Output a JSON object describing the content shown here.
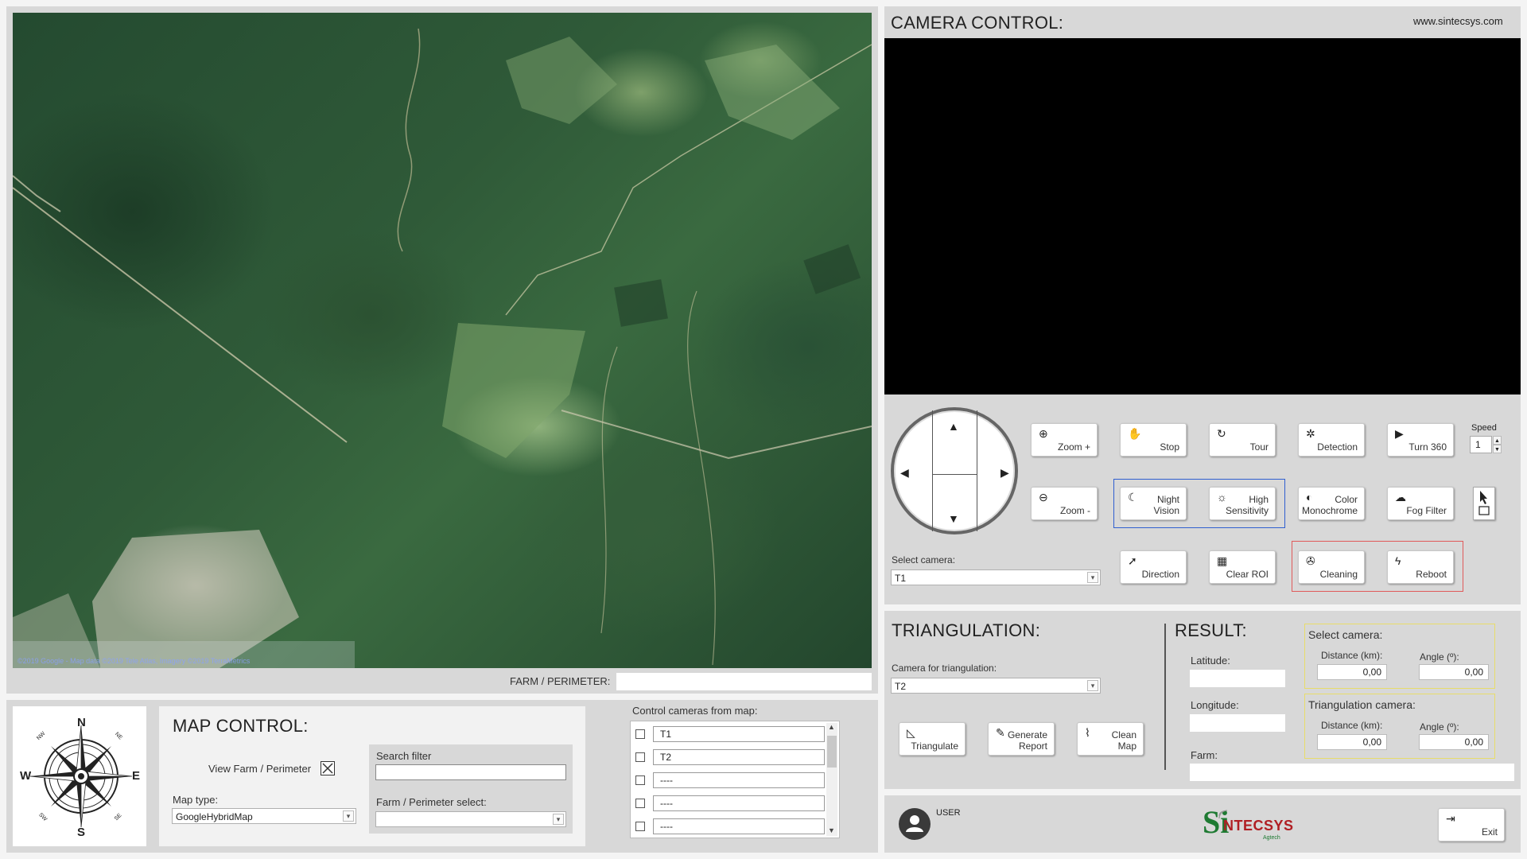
{
  "map": {
    "credit": "©2019 Google - Map data ©2019 Tele Atlas, Imagery ©2019 TerraMetrics",
    "farm_label": "FARM / PERIMETER:",
    "farm_value": ""
  },
  "compass": {
    "n": "N",
    "s": "S",
    "e": "E",
    "w": "W",
    "ne": "NE",
    "nw": "NW",
    "se": "SE",
    "sw": "SW"
  },
  "map_control": {
    "title": "MAP CONTROL:",
    "view_farm_label": "View Farm / Perimeter",
    "view_farm_checked": true,
    "map_type_label": "Map type:",
    "map_type_value": "GoogleHybridMap",
    "search_filter_label": "Search filter",
    "search_filter_value": "",
    "farm_select_label": "Farm / Perimeter select:",
    "farm_select_value": ""
  },
  "control_cameras": {
    "label": "Control cameras from map:",
    "items": [
      {
        "label": "T1",
        "checked": false
      },
      {
        "label": "T2",
        "checked": false
      },
      {
        "label": "----",
        "checked": false
      },
      {
        "label": "----",
        "checked": false
      },
      {
        "label": "----",
        "checked": false
      }
    ]
  },
  "camera_control": {
    "title": "CAMERA CONTROL:",
    "website": "www.sintecsys.com",
    "select_camera_label": "Select camera:",
    "select_camera_value": "T1",
    "speed_label": "Speed",
    "speed_value": "1",
    "buttons": {
      "zoom_in": "Zoom +",
      "zoom_out": "Zoom -",
      "stop": "Stop",
      "tour": "Tour",
      "detection": "Detection",
      "turn360": "Turn  360",
      "night_vision_1": "Night",
      "night_vision_2": "Vision",
      "high_sens_1": "High",
      "high_sens_2": "Sensitivity",
      "color_mono_1": "Color",
      "color_mono_2": "Monochrome",
      "fog_filter": "Fog Filter",
      "direction": "Direction",
      "clear_roi": "Clear ROI",
      "cleaning": "Cleaning",
      "reboot": "Reboot"
    }
  },
  "triangulation": {
    "title": "TRIANGULATION:",
    "camera_label": "Camera for triangulation:",
    "camera_value": "T2",
    "triangulate": "Triangulate",
    "generate_report_1": "Generate",
    "generate_report_2": "Report",
    "clean_map_1": "Clean",
    "clean_map_2": "Map"
  },
  "result": {
    "title": "RESULT:",
    "latitude_label": "Latitude:",
    "latitude_value": "",
    "longitude_label": "Longitude:",
    "longitude_value": "",
    "farm_label": "Farm:",
    "farm_value": "",
    "select_camera_title": "Select camera:",
    "triangulation_camera_title": "Triangulation camera:",
    "distance_label": "Distance (km):",
    "angle_label": "Angle (º):",
    "sel_distance": "0,00",
    "sel_angle": "0,00",
    "tri_distance": "0,00",
    "tri_angle": "0,00"
  },
  "footer": {
    "user": "USER",
    "logo_si": "Si",
    "logo_ntecsys": "NTECSYS",
    "logo_agtech": "Agtech",
    "exit": "Exit"
  },
  "colors": {
    "panel": "#d8d8d8",
    "highlight_blue": "#2f5fd0",
    "highlight_red": "#e05a5a",
    "highlight_yellow": "#e8dc6a",
    "logo_green": "#1e7a32",
    "logo_red": "#b01e23"
  }
}
